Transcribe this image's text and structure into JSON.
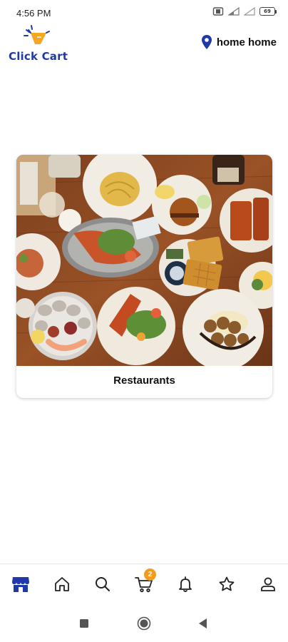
{
  "status_bar": {
    "time": "4:56 PM",
    "battery_level": "69",
    "icons": [
      "vibrate-icon",
      "signal-icon",
      "signal-icon",
      "battery-icon"
    ]
  },
  "header": {
    "logo_text": "Click Cart",
    "location_label": "home home",
    "location_icon": "location-pin-icon"
  },
  "categories": [
    {
      "label": "Restaurants",
      "image": "restaurant-food-table-photo"
    }
  ],
  "bottom_nav": {
    "items": [
      {
        "name": "store-icon",
        "active": true
      },
      {
        "name": "home-icon",
        "active": false
      },
      {
        "name": "search-icon",
        "active": false
      },
      {
        "name": "cart-icon",
        "active": false
      },
      {
        "name": "bell-icon",
        "active": false
      },
      {
        "name": "star-icon",
        "active": false
      },
      {
        "name": "profile-icon",
        "active": false
      }
    ],
    "cart_badge": "2"
  },
  "system_nav": [
    "recents-button",
    "home-button",
    "back-button"
  ],
  "colors": {
    "brand_blue": "#1f3aa8",
    "nav_active": "#1f3aa8",
    "badge_orange": "#f29b1d",
    "logo_orange": "#f5a623"
  }
}
